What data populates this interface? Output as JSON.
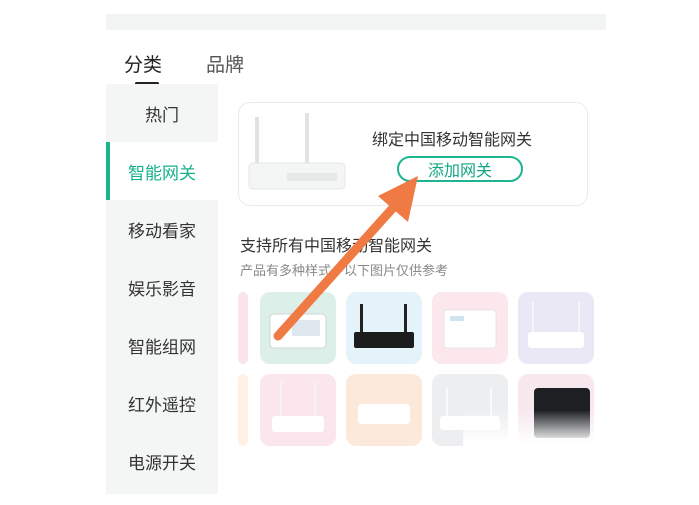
{
  "tabs": {
    "category": "分类",
    "brand": "品牌"
  },
  "sidebar": {
    "items": [
      {
        "label": "热门"
      },
      {
        "label": "智能网关"
      },
      {
        "label": "移动看家"
      },
      {
        "label": "娱乐影音"
      },
      {
        "label": "智能组网"
      },
      {
        "label": "红外遥控"
      },
      {
        "label": "电源开关"
      }
    ],
    "active_index": 1
  },
  "bind_card": {
    "title": "绑定中国移动智能网关",
    "button_label": "添加网关"
  },
  "section": {
    "title": "支持所有中国移动智能网关",
    "subtitle": "产品有多种样式，以下图片仅供参考"
  },
  "colors": {
    "accent": "#16b18c",
    "annotation_arrow": "#f07a43"
  }
}
